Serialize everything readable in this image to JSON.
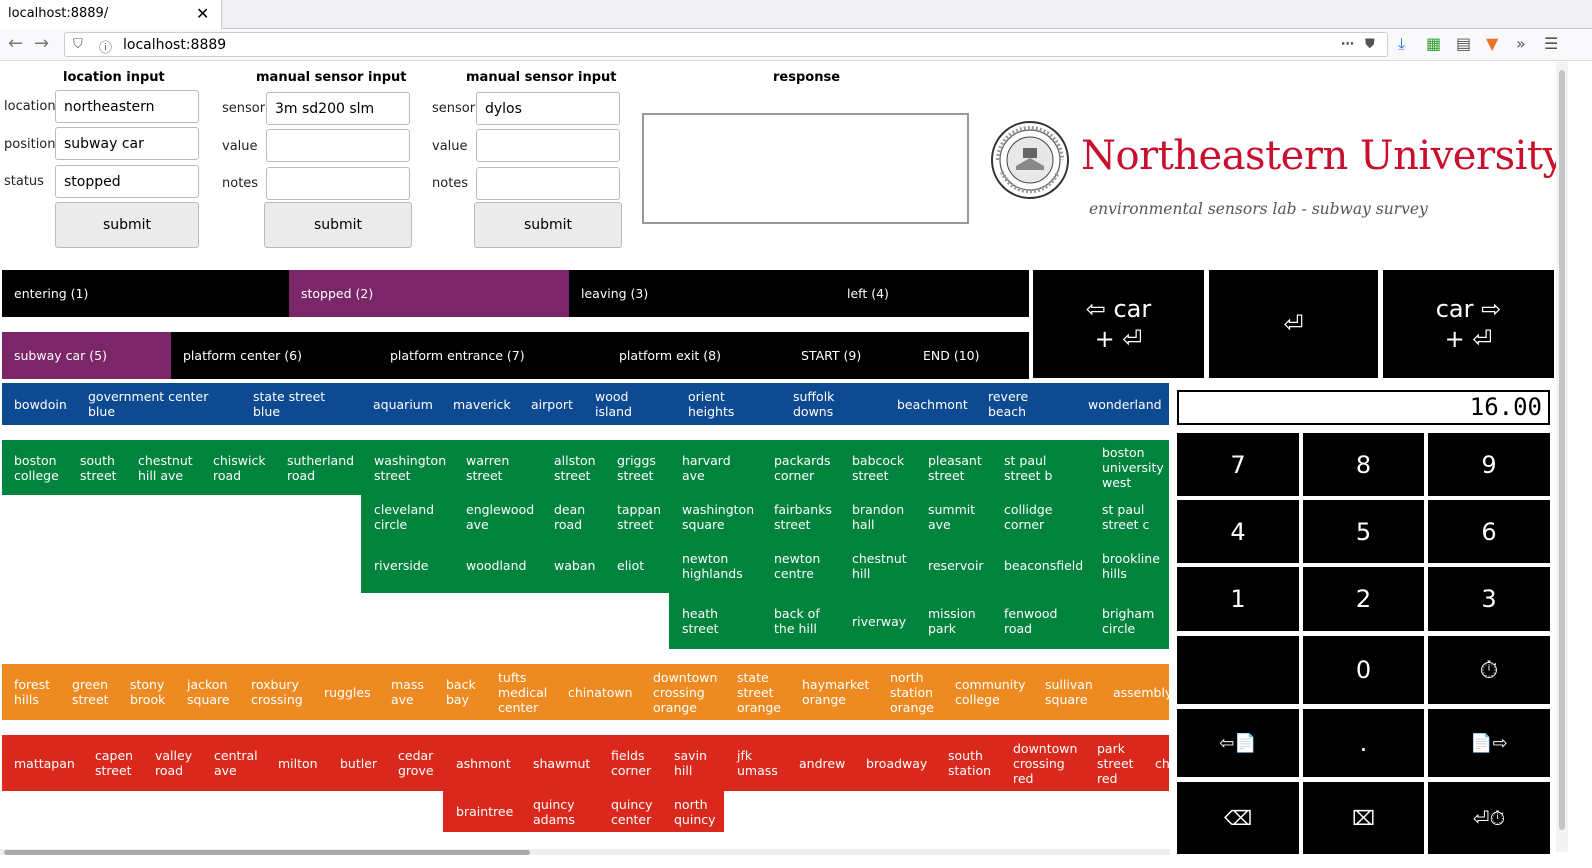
{
  "browser": {
    "tab_title": "localhost:8889/",
    "close_glyph": "✕",
    "url": "localhost:8889",
    "back_glyph": "←",
    "forward_glyph": "→"
  },
  "location_form": {
    "heading": "location input",
    "labels": {
      "location": "location",
      "position": "position",
      "status": "status"
    },
    "values": {
      "location": "northeastern",
      "position": "subway car",
      "status": "stopped"
    },
    "submit": "submit"
  },
  "sensor_form_1": {
    "heading": "manual sensor input",
    "labels": {
      "sensor": "sensor",
      "value": "value",
      "notes": "notes"
    },
    "values": {
      "sensor": "3m sd200 slm",
      "value": "",
      "notes": ""
    },
    "submit": "submit"
  },
  "sensor_form_2": {
    "heading": "manual sensor input",
    "labels": {
      "sensor": "sensor",
      "value": "value",
      "notes": "notes"
    },
    "values": {
      "sensor": "dylos",
      "value": "",
      "notes": ""
    },
    "submit": "submit"
  },
  "response": {
    "heading": "response",
    "text": ""
  },
  "brand": {
    "name": "Northeastern University",
    "subtitle": "environmental sensors lab - subway survey",
    "color": "#c8102e"
  },
  "status_bar": [
    "entering (1)",
    "stopped (2)",
    "leaving (3)",
    "left (4)"
  ],
  "position_bar": [
    "subway car (5)",
    "platform center (6)",
    "platform entrance (7)",
    "platform exit (8)",
    "START (9)",
    "END (10)"
  ],
  "big_buttons": {
    "prev_car": {
      "line1": "⇦ car",
      "line2": "+ ⏎"
    },
    "enter": {
      "line1": "⏎"
    },
    "next_car": {
      "line1": "car ⇨",
      "line2": "+ ⏎"
    }
  },
  "lines": {
    "blue": {
      "color": "#0e4a92",
      "stops": [
        "bowdoin",
        "government center\nblue",
        "state street\nblue",
        "aquarium",
        "maverick",
        "airport",
        "wood\nisland",
        "orient\nheights",
        "suffolk\ndowns",
        "beachmont",
        "revere\nbeach",
        "wonderland"
      ]
    },
    "green": {
      "color": "#00843d",
      "stops": [
        "boston\ncollege",
        "south\nstreet",
        "chestnut\nhill ave",
        "chiswick\nroad",
        "sutherland\nroad",
        "washington\nstreet",
        "warren\nstreet",
        "allston\nstreet",
        "griggs\nstreet",
        "harvard\nave",
        "packards\ncorner",
        "babcock\nstreet",
        "pleasant\nstreet",
        "st paul\nstreet b",
        "boston\nuniversity\nwest",
        "cleveland\ncircle",
        "englewood\nave",
        "dean\nroad",
        "tappan\nstreet",
        "washington\nsquare",
        "fairbanks\nstreet",
        "brandon\nhall",
        "summit\nave",
        "collidge\ncorner",
        "st paul\nstreet c",
        "riverside",
        "woodland",
        "waban",
        "eliot",
        "newton\nhighlands",
        "newton\ncentre",
        "chestnut\nhill",
        "reservoir",
        "beaconsfield",
        "brookline\nhills",
        "heath\nstreet",
        "back of\nthe hill",
        "riverway",
        "mission\npark",
        "fenwood\nroad",
        "brigham\ncircle"
      ]
    },
    "orange": {
      "color": "#ed8b22",
      "stops": [
        "forest\nhills",
        "green\nstreet",
        "stony\nbrook",
        "jackon\nsquare",
        "roxbury\ncrossing",
        "ruggles",
        "mass\nave",
        "back\nbay",
        "tufts\nmedical\ncenter",
        "chinatown",
        "downtown\ncrossing\norange",
        "state\nstreet\norange",
        "haymarket\norange",
        "north\nstation\norange",
        "community\ncollege",
        "sullivan\nsquare",
        "assembly"
      ]
    },
    "red": {
      "color": "#da291c",
      "stops": [
        "mattapan",
        "capen\nstreet",
        "valley\nroad",
        "central\nave",
        "milton",
        "butler",
        "cedar\ngrove",
        "ashmont",
        "shawmut",
        "fields\ncorner",
        "savin\nhill",
        "jfk\numass",
        "andrew",
        "broadway",
        "south\nstation",
        "downtown\ncrossing\nred",
        "park\nstreet\nred",
        "ch",
        "braintree",
        "quincy\nadams",
        "quincy\ncenter",
        "north\nquincy"
      ]
    }
  },
  "keypad": {
    "display": "16.00",
    "keys": [
      "7",
      "8",
      "9",
      "4",
      "5",
      "6",
      "1",
      "2",
      "3",
      "",
      "0",
      "⏱",
      "⇦📄",
      ".",
      "📄⇨",
      "⌫",
      "⌧",
      "⏎⏱"
    ]
  },
  "colors": {
    "active": "#7b2669",
    "bar": "#000000"
  }
}
